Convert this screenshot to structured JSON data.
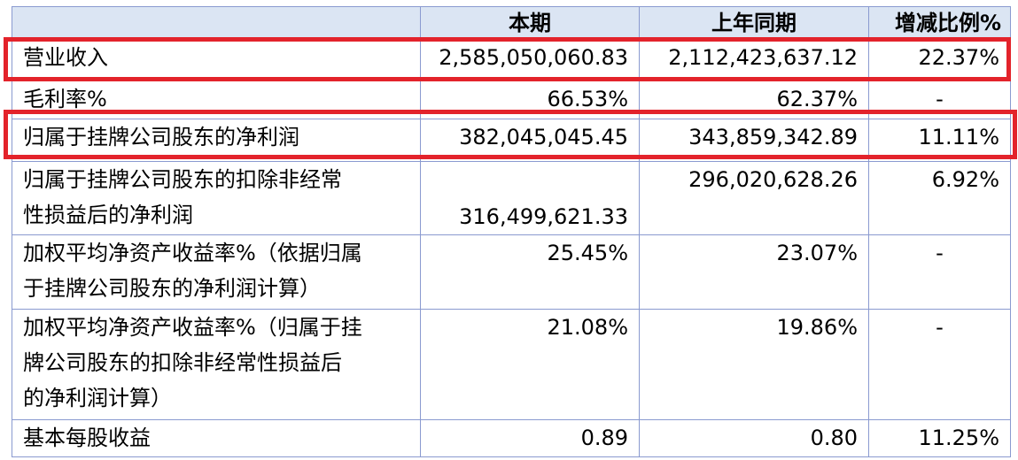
{
  "header": {
    "col_label": "",
    "col_current": "本期",
    "col_prior": "上年同期",
    "col_change": "增减比例%"
  },
  "rows": [
    {
      "label": "营业收入",
      "current": "2,585,050,060.83",
      "prior": "2,112,423,637.12",
      "change": "22.37%"
    },
    {
      "label": "毛利率%",
      "current": "66.53%",
      "prior": "62.37%",
      "change": "-"
    },
    {
      "label": "归属于挂牌公司股东的净利润",
      "current": "382,045,045.45",
      "prior": "343,859,342.89",
      "change": "11.11%"
    },
    {
      "label_lines": [
        "归属于挂牌公司股东的扣除非经常",
        "性损益后的净利润"
      ],
      "current": "316,499,621.33",
      "prior": "296,020,628.26",
      "change": "6.92%"
    },
    {
      "label_lines": [
        "加权平均净资产收益率%（依据归属",
        "于挂牌公司股东的净利润计算）"
      ],
      "current": "25.45%",
      "prior": "23.07%",
      "change": "-"
    },
    {
      "label_lines": [
        "加权平均净资产收益率%（归属于挂",
        "牌公司股东的扣除非经常性损益后",
        "的净利润计算）"
      ],
      "current": "21.08%",
      "prior": "19.86%",
      "change": "-"
    },
    {
      "label": "基本每股收益",
      "current": "0.89",
      "prior": "0.80",
      "change": "11.25%"
    }
  ],
  "highlight_color": "#e3232b"
}
